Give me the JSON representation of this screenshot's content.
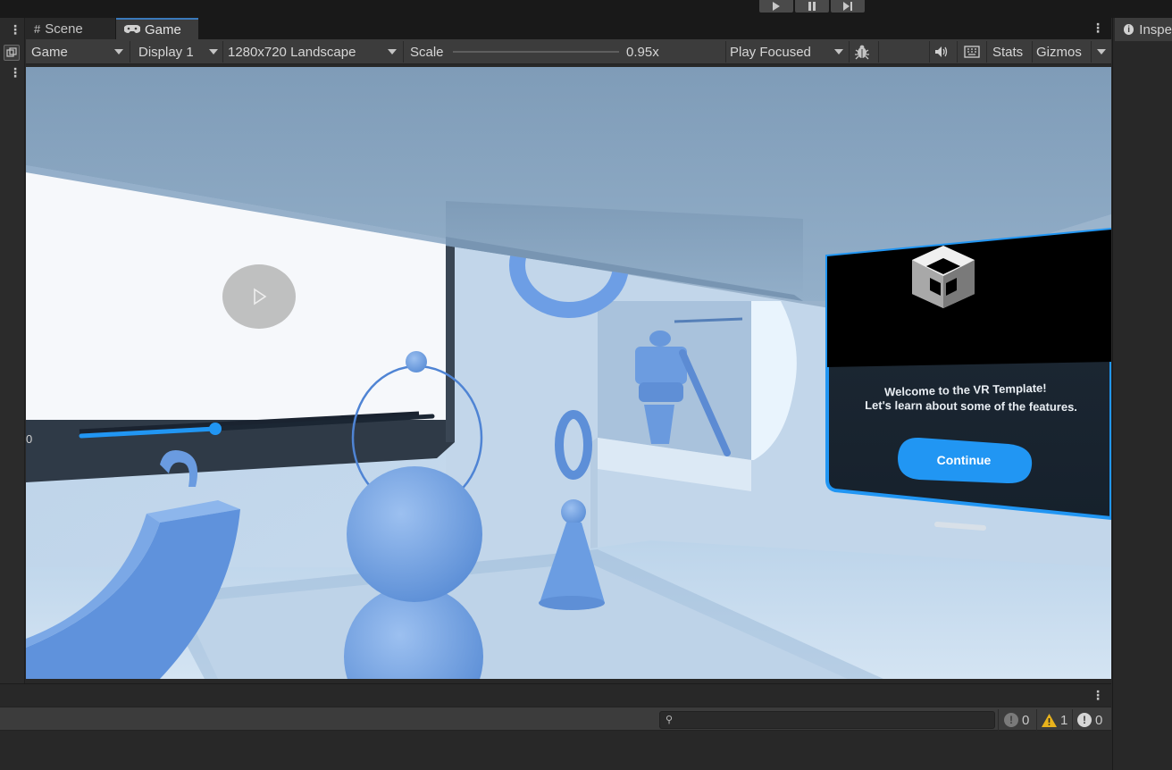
{
  "tabs": [
    {
      "label": "Scene",
      "icon": "grid-icon"
    },
    {
      "label": "Game",
      "icon": "gamepad-icon"
    }
  ],
  "toolbar": {
    "view_mode": "Game",
    "display": "Display 1",
    "resolution": "1280x720 Landscape",
    "scale_label": "Scale",
    "scale_value": "0.95x",
    "scale_fraction": 0.0,
    "play_mode": "Play Focused",
    "stats_label": "Stats",
    "gizmos_label": "Gizmos"
  },
  "game_scene": {
    "video_time_partial": "0",
    "video_progress": 0.43,
    "welcome_title": "Welcome to the VR Template!",
    "welcome_subtitle": "Let's learn about some of the features.",
    "continue_label": "Continue"
  },
  "inspector": {
    "label": "Inspe"
  },
  "console": {
    "search_placeholder": "",
    "error_count": "0",
    "warning_count": "1",
    "info_count": "0"
  },
  "colors": {
    "editor_bg": "#282828",
    "toolbar_bg": "#3c3c3c",
    "accent_blue": "#3a79bb",
    "vr_blue": "#2196f3",
    "warning_yellow": "#e8b21c"
  }
}
